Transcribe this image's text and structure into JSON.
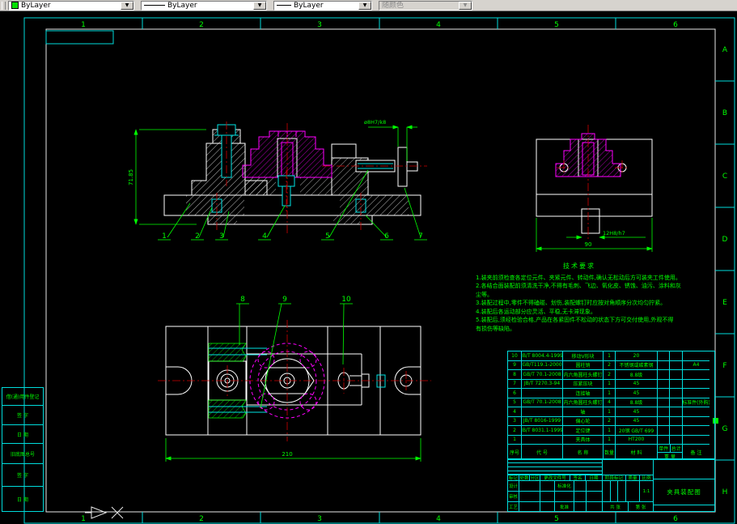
{
  "toolbar": {
    "color_label": "ByLayer",
    "linetype_label": "ByLayer",
    "lineweight_label": "ByLayer",
    "plotstyle_label": "随颜色"
  },
  "zones": {
    "top": [
      "1",
      "2",
      "3",
      "4",
      "5",
      "6"
    ],
    "bottom": [
      "1",
      "2",
      "3",
      "4",
      "5",
      "6"
    ],
    "right": [
      "A",
      "B",
      "C",
      "D",
      "E",
      "F",
      "G",
      "H"
    ]
  },
  "dimensions": {
    "front_height": "71.85",
    "front_fit": "ø8H7/k8",
    "side_slot": "12H8/h7",
    "side_width": "90",
    "plan_width": "210"
  },
  "balloons": [
    "1",
    "2",
    "3",
    "4",
    "5",
    "6",
    "7",
    "8",
    "9",
    "10"
  ],
  "tech_requirements": {
    "title": "技术要求",
    "lines": [
      "1.装夹前须检查各定位元件、夹紧元件、转动件,确认无松动后方可装夹工件使用。",
      "2.各结合面装配前须清洗干净,不得有毛刺、飞边、氧化皮、锈蚀、油污、涂料和灰",
      "尘等。",
      "3.装配过程中,零件不得磕碰、划伤,装配螺钉时应按对角顺序分次均匀拧紧。",
      "4.装配后各运动部分应灵活、平稳,无卡滞现象。",
      "5.装配后,须经检验合格,产品在各紧固件不松动的状态下方可交付使用,外观不得",
      "有损伤等缺陷。"
    ]
  },
  "bom": {
    "headers": {
      "no": "序号",
      "code": "代  号",
      "name": "名  称",
      "qty": "数量",
      "material": "材  料",
      "unit": "单件",
      "total": "总计",
      "weight": "重 量",
      "remark": "备  注"
    },
    "rows": [
      {
        "no": "10",
        "code": "JB/T 8004.4-1999",
        "name": "移动V形块",
        "qty": "1",
        "material": "20",
        "unit": "",
        "total": "",
        "remark": ""
      },
      {
        "no": "9",
        "code": "GB/T119.1-2000",
        "name": "圆柱销",
        "qty": "2",
        "material": "不锈钢或碳素钢",
        "unit": "",
        "total": "",
        "remark": "A4"
      },
      {
        "no": "8",
        "code": "GB/T 70.1-2008",
        "name": "内六角圆柱头螺钉",
        "qty": "2",
        "material": "8.8级",
        "unit": "",
        "total": "",
        "remark": ""
      },
      {
        "no": "7",
        "code": "JB/T 7270.3-94",
        "name": "压紧压块",
        "qty": "1",
        "material": "45",
        "unit": "",
        "total": "",
        "remark": ""
      },
      {
        "no": "6",
        "code": "",
        "name": "连接轴",
        "qty": "1",
        "material": "45",
        "unit": "",
        "total": "",
        "remark": ""
      },
      {
        "no": "5",
        "code": "GB/T 70.1-2008",
        "name": "内六角圆柱头螺钉",
        "qty": "4",
        "material": "8.8级",
        "unit": "",
        "total": "",
        "remark": "标准件(外购)"
      },
      {
        "no": "4",
        "code": "",
        "name": "轴",
        "qty": "1",
        "material": "45",
        "unit": "",
        "total": "",
        "remark": ""
      },
      {
        "no": "3",
        "code": "JB/T 8016-1999",
        "name": "偏心轮",
        "qty": "2",
        "material": "45",
        "unit": "",
        "total": "",
        "remark": ""
      },
      {
        "no": "2",
        "code": "JB/T 8031.1-1999",
        "name": "定位键",
        "qty": "1",
        "material": "20钢 GB/T 699",
        "unit": "",
        "total": "",
        "remark": ""
      },
      {
        "no": "1",
        "code": "",
        "name": "夹具体",
        "qty": "1",
        "material": "HT200",
        "unit": "",
        "total": "",
        "remark": ""
      }
    ]
  },
  "title_block": {
    "labels": {
      "mark": "标记",
      "count": "处数",
      "zone": "分区",
      "doc": "更改文件号",
      "sign": "签名",
      "date": "日期",
      "design": "设计",
      "standard": "标准化",
      "stage": "阶段标记",
      "weight": "质量",
      "scale_lbl": "比例",
      "check": "审核",
      "process": "工艺",
      "approve": "批准",
      "sheets": "共 张",
      "page": "第 张"
    },
    "scale": "1:1",
    "title": "夹具装配图"
  },
  "left_panel": {
    "rows": [
      "借(通)用件登记",
      "签 字",
      "日 期",
      "旧底图总号",
      "签 字",
      "日 期"
    ]
  },
  "colors": {
    "background": "#000000",
    "geometry": "#ffffff",
    "frame": "#00dcdc",
    "annotation": "#00ff00",
    "centerline": "#d00000",
    "workpiece": "#ff00ff"
  }
}
